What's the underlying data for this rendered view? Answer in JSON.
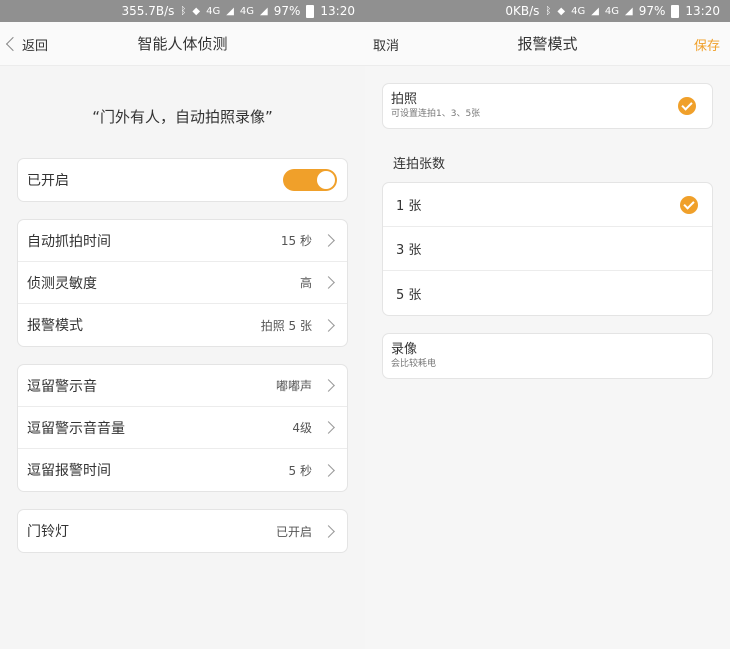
{
  "left": {
    "statusbar": {
      "speed": "355.7B/s",
      "net1": "4G",
      "net2": "4G",
      "battery": "97%",
      "time": "13:20"
    },
    "nav": {
      "back_label": "返回",
      "title": "智能人体侦测"
    },
    "slogan": "“门外有人，自动拍照录像”",
    "toggle_row": {
      "label": "已开启",
      "on": true
    },
    "group1": [
      {
        "label": "自动抓拍时间",
        "value": "15 秒"
      },
      {
        "label": "侦测灵敏度",
        "value": "高"
      },
      {
        "label": "报警模式",
        "value": "拍照 5 张"
      }
    ],
    "group2": [
      {
        "label": "逗留警示音",
        "value": "嘟嘟声"
      },
      {
        "label": "逗留警示音音量",
        "value": "4级"
      },
      {
        "label": "逗留报警时间",
        "value": "5 秒"
      }
    ],
    "group3": [
      {
        "label": "门铃灯",
        "value": "已开启"
      }
    ]
  },
  "right": {
    "statusbar": {
      "speed": "0KB/s",
      "net1": "4G",
      "net2": "4G",
      "battery": "97%",
      "time": "13:20"
    },
    "nav": {
      "cancel_label": "取消",
      "title": "报警模式",
      "save_label": "保存"
    },
    "photo_option": {
      "title": "拍照",
      "subtitle": "可设置连拍1、3、5张",
      "selected": true
    },
    "burst_section_title": "连拍张数",
    "burst_options": [
      {
        "label": "1 张",
        "selected": true
      },
      {
        "label": "3 张",
        "selected": false
      },
      {
        "label": "5 张",
        "selected": false
      }
    ],
    "video_option": {
      "title": "录像",
      "subtitle": "会比较耗电",
      "selected": false
    }
  },
  "colors": {
    "accent": "#f0a02a",
    "statusbar": "#909090"
  }
}
